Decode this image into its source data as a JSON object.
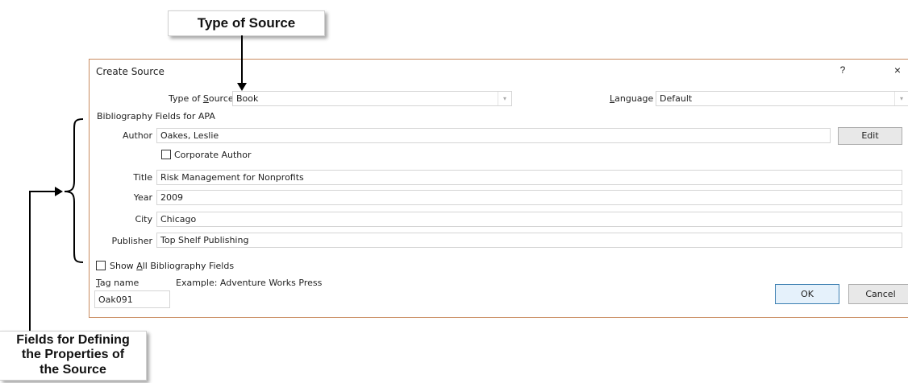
{
  "callouts": {
    "type_of_source": "Type of Source",
    "fields_line1": "Fields for Defining",
    "fields_line2": "the Properties of",
    "fields_line3": "the Source"
  },
  "dialog": {
    "title": "Create Source",
    "help": "?",
    "close": "×",
    "type_of_source_label_pre": "Type of ",
    "type_of_source_label_key": "S",
    "type_of_source_label_post": "ource",
    "type_of_source_value": "Book",
    "language_label_key": "L",
    "language_label_post": "anguage",
    "language_value": "Default",
    "section_heading": "Bibliography Fields for APA",
    "author_label": "Author",
    "author_value": "Oakes, Leslie",
    "edit_button": "Edit",
    "corporate_author_label": "Corporate Author",
    "title_label": "Title",
    "title_value": "Risk Management for Nonprofits",
    "year_label": "Year",
    "year_value": "2009",
    "city_label": "City",
    "city_value": "Chicago",
    "publisher_label": "Publisher",
    "publisher_value": "Top Shelf Publishing",
    "show_all_pre": "Show ",
    "show_all_key": "A",
    "show_all_post": "ll Bibliography Fields",
    "tag_name_key": "T",
    "tag_name_post": "ag name",
    "example_text": "Example: Adventure Works Press",
    "tag_value": "Oak091",
    "ok_button": "OK",
    "cancel_button": "Cancel"
  },
  "colors": {
    "dialog_border": "#c98b5f",
    "ok_border": "#3c7fb1"
  }
}
